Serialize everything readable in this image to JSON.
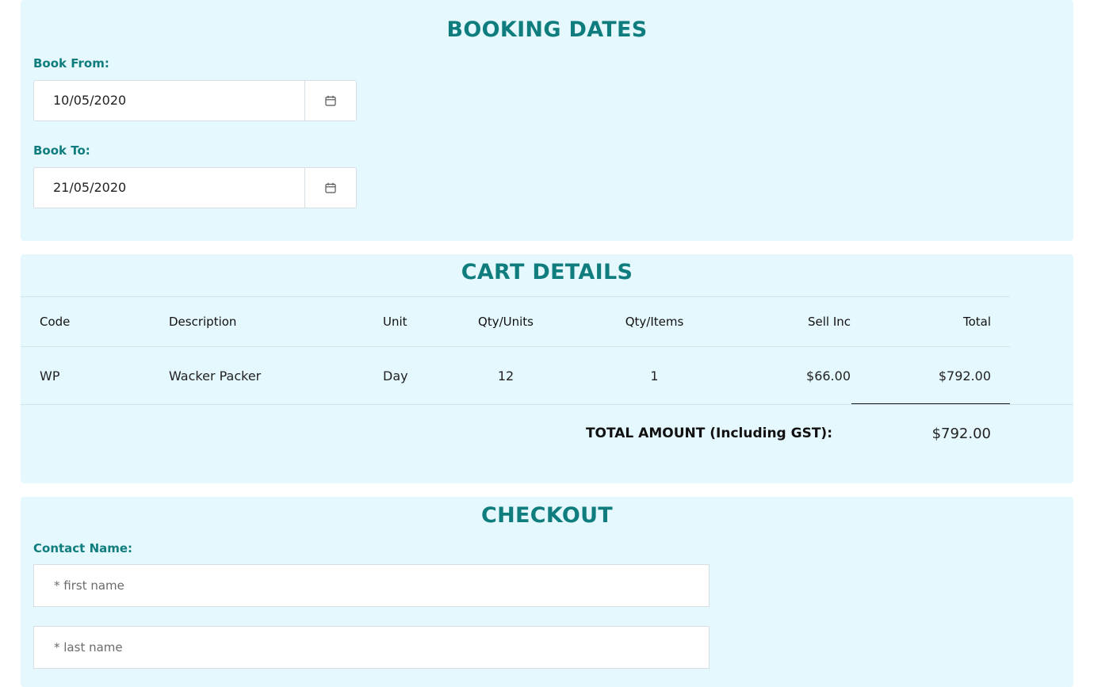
{
  "booking": {
    "title": "BOOKING DATES",
    "from_label": "Book From:",
    "from_value": "10/05/2020",
    "to_label": "Book To:",
    "to_value": "21/05/2020",
    "calendar_icon": "calendar-icon"
  },
  "cart": {
    "title": "CART DETAILS",
    "headers": {
      "code": "Code",
      "description": "Description",
      "unit": "Unit",
      "qty_units": "Qty/Units",
      "qty_items": "Qty/Items",
      "sell_inc": "Sell Inc",
      "total": "Total"
    },
    "rows": [
      {
        "code": "WP",
        "description": "Wacker Packer",
        "unit": "Day",
        "qty_units": "12",
        "qty_items": "1",
        "sell_inc": "$66.00",
        "total": "$792.00"
      }
    ],
    "total_label": "TOTAL AMOUNT (Including GST):",
    "total_value": "$792.00"
  },
  "checkout": {
    "title": "CHECKOUT",
    "contact_label": "Contact Name:",
    "first_name_placeholder": "* first name",
    "last_name_placeholder": "* last name"
  },
  "colors": {
    "accent": "#0f7d7e",
    "panel_bg": "#e5f8fd"
  }
}
